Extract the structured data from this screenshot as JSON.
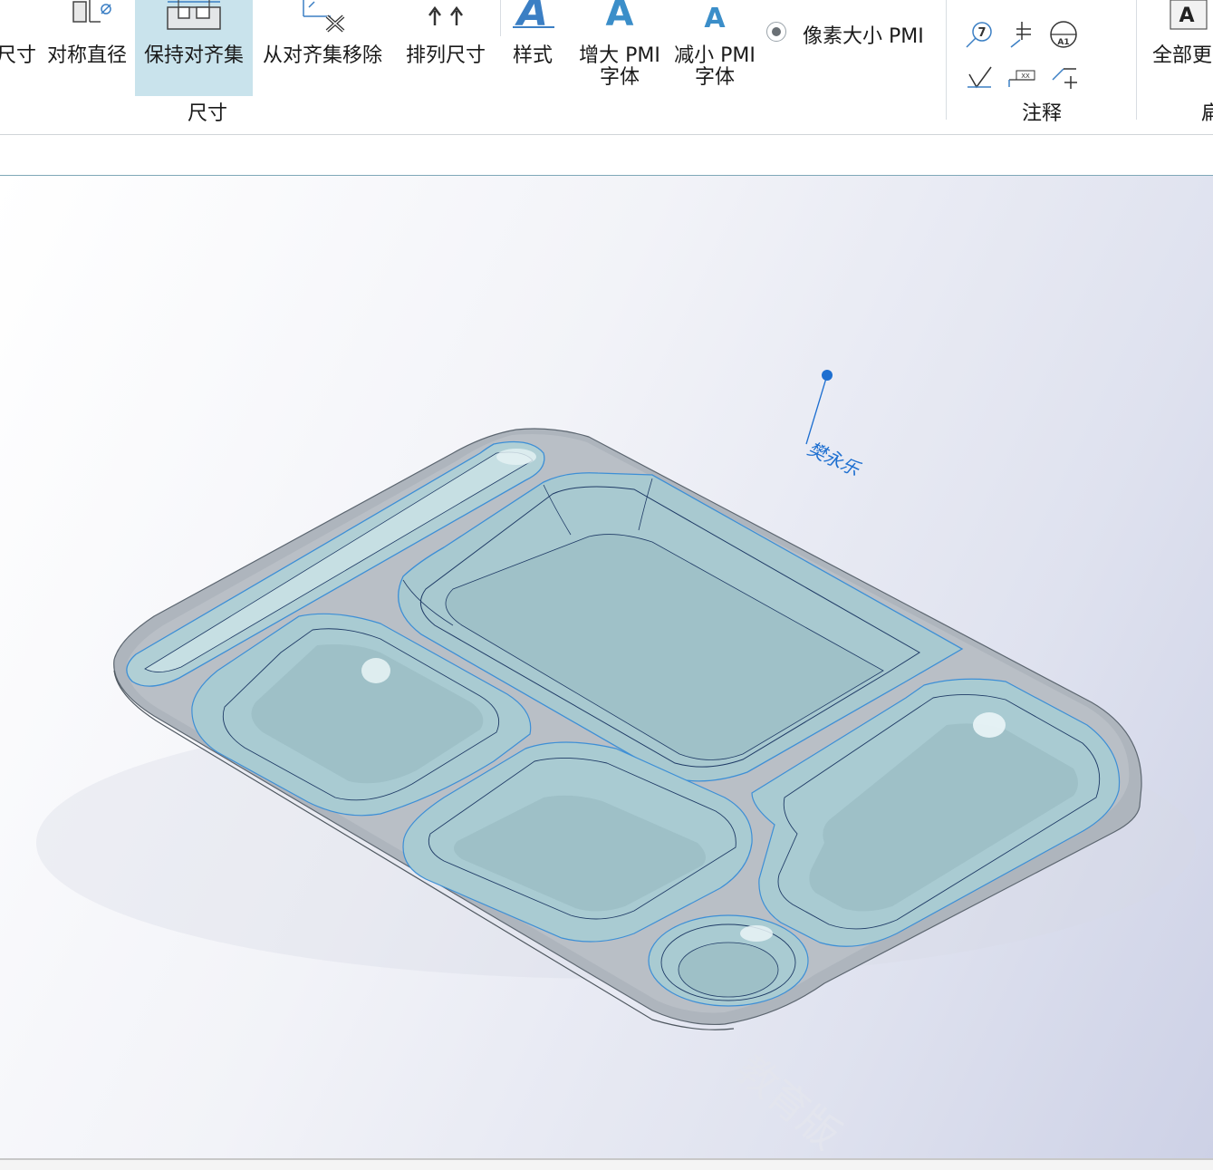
{
  "ribbon": {
    "dimension_group": {
      "label": "尺寸",
      "buttons": [
        {
          "label": "尺寸"
        },
        {
          "label": "对称直径"
        },
        {
          "label": "保持对齐集"
        },
        {
          "label": "从对齐集移除"
        },
        {
          "label": "排列尺寸"
        }
      ]
    },
    "format_buttons": [
      {
        "label": "样式"
      },
      {
        "label": "增大 PMI\n字体"
      },
      {
        "label": "减小 PMI\n字体"
      }
    ],
    "radio_option": {
      "label": "像素大小 PMI"
    },
    "annotation_group": {
      "label": "注释"
    },
    "update_button": {
      "label": "全部更"
    },
    "partial_group_label": "扁"
  },
  "viewport": {
    "annotation_note": "樊永乐",
    "watermark": "教育版"
  },
  "colors": {
    "active_button_bg": "#c9e3ec",
    "tray_body": "#adb4bc",
    "tray_face": "#b3d1d6",
    "selection_edge": "#3d8fd6",
    "annotation_blue": "#1e6fd0"
  }
}
